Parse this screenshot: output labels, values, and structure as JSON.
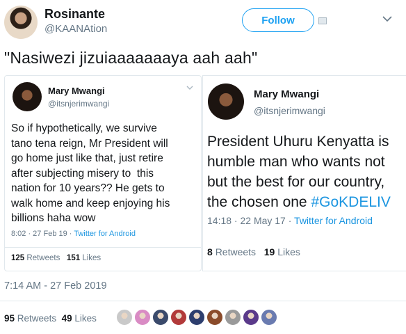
{
  "main": {
    "name": "Rosinante",
    "handle": "@KAANAtion",
    "follow_label": "Follow",
    "text": "\"Nasiwezi jizuiaaaaaaaya aah aah\"",
    "timestamp": "7:14 AM - 27 Feb 2019",
    "retweets_count": "95",
    "retweets_label": "Retweets",
    "likes_count": "49",
    "likes_label": "Likes"
  },
  "left_card": {
    "name": "Mary Mwangi",
    "handle": "@itsnjerimwangi",
    "lines": [
      "So if hypothetically, we survive",
      "tano tena reign, Mr President will",
      "go home just like that, just retire",
      "after subjecting misery to  this",
      "nation for 10 years?? He gets to",
      "walk home and keep enjoying his",
      "billions haha wow"
    ],
    "meta_time": "8:02 · 27 Feb 19 · ",
    "meta_source": "Twitter for Android",
    "retweets_count": "125",
    "retweets_label": "Retweets",
    "likes_count": "151",
    "likes_label": "Likes"
  },
  "right_card": {
    "name": "Mary Mwangi",
    "handle": "@itsnjerimwangi",
    "lines": [
      "President Uhuru Kenyatta is",
      "humble man who wants not",
      "but the best for our country,",
      "the chosen one "
    ],
    "hashtag": "#GoKDELIV",
    "meta_time": "14:18 · 22 May 17 · ",
    "meta_source": "Twitter for Android",
    "retweets_count": "8",
    "retweets_label": "Retweets",
    "likes_count": "19",
    "likes_label": "Likes"
  },
  "likers": [
    "#c9c9c9",
    "#d98bc4",
    "#3a4a6b",
    "#b23a3a",
    "#2d3e6e",
    "#8a4b2a",
    "#9a9a9a",
    "#5a3a8a",
    "#6a7bb0"
  ],
  "colors": {
    "accent": "#1da1f2",
    "link": "#1b95e0",
    "muted": "#657786"
  }
}
